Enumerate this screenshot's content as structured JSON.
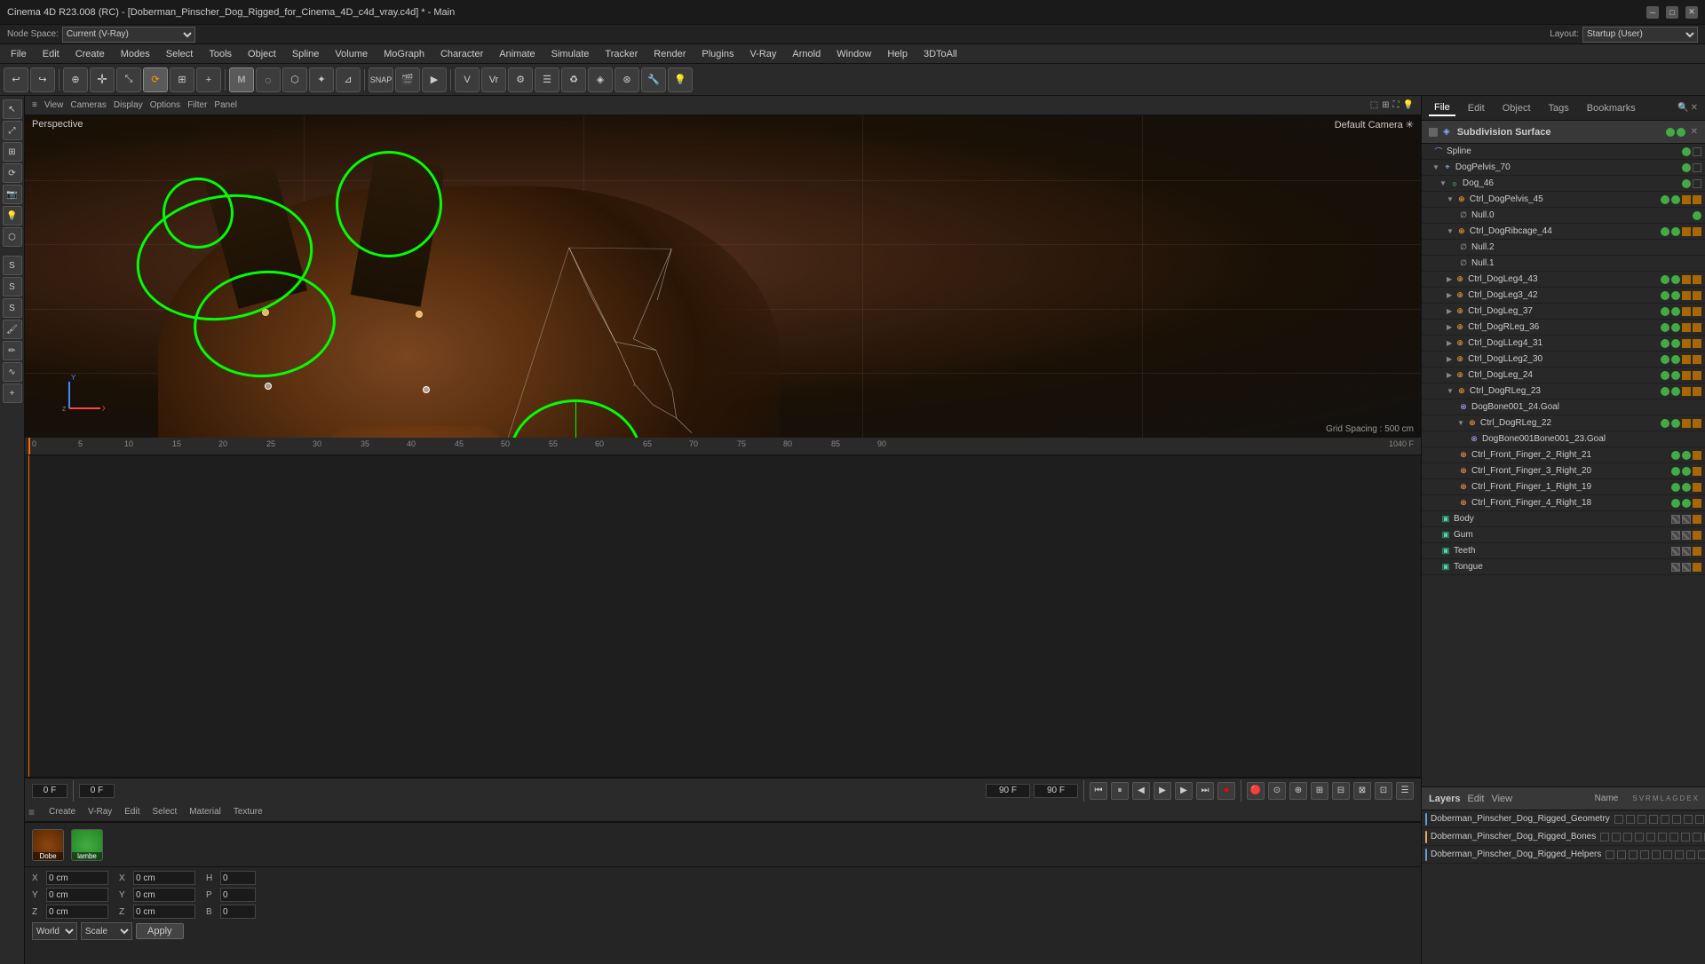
{
  "titlebar": {
    "title": "Cinema 4D R23.008 (RC) - [Doberman_Pinscher_Dog_Rigged_for_Cinema_4D_c4d_vray.c4d] * - Main",
    "minimize": "─",
    "maximize": "□",
    "close": "✕"
  },
  "menubar": {
    "items": [
      "File",
      "Edit",
      "Create",
      "Modes",
      "Select",
      "Tools",
      "Object",
      "Spline",
      "Volume",
      "MoGraph",
      "Character",
      "Animate",
      "Simulate",
      "Tracker",
      "Render",
      "Plugins",
      "V-Ray",
      "Arnold",
      "Window",
      "Help",
      "3DToAll"
    ]
  },
  "viewport": {
    "label": "Perspective",
    "camera": "Default Camera ✳",
    "grid_spacing": "Grid Spacing : 500 cm"
  },
  "node_space": {
    "label": "Node Space:",
    "value": "Current (V-Ray)"
  },
  "layout": {
    "label": "Layout:",
    "value": "Startup (User)"
  },
  "object_manager": {
    "tabs": [
      "File",
      "Edit",
      "Object",
      "Tags",
      "Bookmarks"
    ],
    "subdivision_surface": "Subdivision Surface",
    "items": [
      {
        "label": "Spline",
        "indent": 1,
        "has_fold": false,
        "icon": "spline"
      },
      {
        "label": "DogPelvis_70",
        "indent": 1,
        "has_fold": true,
        "icon": "bone"
      },
      {
        "label": "Dog_46",
        "indent": 2,
        "has_fold": true,
        "icon": "obj"
      },
      {
        "label": "Ctrl_DogPelvis_45",
        "indent": 3,
        "has_fold": true,
        "icon": "ctrl"
      },
      {
        "label": "Null.0",
        "indent": 4,
        "has_fold": false,
        "icon": "null"
      },
      {
        "label": "Ctrl_DogRibcage_44",
        "indent": 3,
        "has_fold": true,
        "icon": "ctrl"
      },
      {
        "label": "Null.2",
        "indent": 4,
        "has_fold": false,
        "icon": "null"
      },
      {
        "label": "Null.1",
        "indent": 4,
        "has_fold": false,
        "icon": "null"
      },
      {
        "label": "Ctrl_DogLeg4_43",
        "indent": 3,
        "has_fold": true,
        "icon": "ctrl"
      },
      {
        "label": "Ctrl_DogLeg3_42",
        "indent": 3,
        "has_fold": true,
        "icon": "ctrl"
      },
      {
        "label": "Ctrl_DogLeg_37",
        "indent": 3,
        "has_fold": true,
        "icon": "ctrl"
      },
      {
        "label": "Ctrl_DogRLeg_36",
        "indent": 3,
        "has_fold": true,
        "icon": "ctrl"
      },
      {
        "label": "Ctrl_DogLLeg4_31",
        "indent": 3,
        "has_fold": true,
        "icon": "ctrl"
      },
      {
        "label": "Ctrl_DogLLeg2_30",
        "indent": 3,
        "has_fold": true,
        "icon": "ctrl"
      },
      {
        "label": "Ctrl_DogLeg_24",
        "indent": 3,
        "has_fold": true,
        "icon": "ctrl"
      },
      {
        "label": "Ctrl_DogRLeg_23",
        "indent": 3,
        "has_fold": true,
        "icon": "ctrl"
      },
      {
        "label": "DogBone001_24.Goal",
        "indent": 4,
        "has_fold": false,
        "icon": "goal"
      },
      {
        "label": "Ctrl_DogRLeg_22",
        "indent": 4,
        "has_fold": true,
        "icon": "ctrl"
      },
      {
        "label": "DogBone001Bone001_23.Goal",
        "indent": 5,
        "has_fold": false,
        "icon": "goal"
      },
      {
        "label": "Ctrl_Front_Finger_2_Right_21",
        "indent": 4,
        "has_fold": false,
        "icon": "ctrl"
      },
      {
        "label": "Ctrl_Front_Finger_3_Right_20",
        "indent": 4,
        "has_fold": false,
        "icon": "ctrl"
      },
      {
        "label": "Ctrl_Front_Finger_1_Right_19",
        "indent": 4,
        "has_fold": false,
        "icon": "ctrl"
      },
      {
        "label": "Ctrl_Front_Finger_4_Right_18",
        "indent": 4,
        "has_fold": false,
        "icon": "ctrl"
      },
      {
        "label": "Body",
        "indent": 2,
        "has_fold": false,
        "icon": "mesh"
      },
      {
        "label": "Gum",
        "indent": 2,
        "has_fold": false,
        "icon": "mesh"
      },
      {
        "label": "Teeth",
        "indent": 2,
        "has_fold": false,
        "icon": "mesh"
      },
      {
        "label": "Tongue",
        "indent": 2,
        "has_fold": false,
        "icon": "mesh"
      }
    ]
  },
  "layers_panel": {
    "tabs": [
      "Layers",
      "Edit",
      "View"
    ],
    "name_col": "Name",
    "items": [
      {
        "name": "Doberman_Pinscher_Dog_Rigged_Geometry",
        "color": "#4488cc"
      },
      {
        "name": "Doberman_Pinscher_Dog_Rigged_Bones",
        "color": "#cc8844"
      },
      {
        "name": "Doberman_Pinscher_Dog_Rigged_Helpers",
        "color": "#4488cc"
      }
    ]
  },
  "coords": {
    "x_label": "X",
    "x_val": "0 cm",
    "x2_label": "X",
    "x2_val": "0 cm",
    "h_label": "H",
    "h_val": "0",
    "y_label": "Y",
    "y_val": "0 cm",
    "y2_label": "Y",
    "y2_val": "0 cm",
    "p_label": "P",
    "p_val": "0",
    "z_label": "Z",
    "z_val": "0 cm",
    "z2_label": "Z",
    "z2_val": "0 cm",
    "b_label": "B",
    "b_val": "0",
    "world_label": "World",
    "scale_label": "Scale",
    "apply_label": "Apply"
  },
  "materials": {
    "menu": [
      "Create",
      "V-Ray",
      "Edit",
      "Select",
      "Material",
      "Texture"
    ],
    "swatches": [
      {
        "name": "Dobe",
        "color": "#8B4513"
      },
      {
        "name": "lambe",
        "color": "#228B22"
      }
    ]
  },
  "timeline": {
    "marks": [
      "0",
      "5",
      "10",
      "15",
      "20",
      "25",
      "30",
      "35",
      "40",
      "45",
      "50",
      "55",
      "60",
      "65",
      "70",
      "75",
      "80",
      "85",
      "90"
    ],
    "current_frame": "0 F",
    "start_frame": "0 F",
    "end_frame": "90 F",
    "fps_display1": "90 F",
    "fps_display2": "90 F"
  },
  "playback": {
    "record_label": "⏺",
    "prev_end": "⏮",
    "prev_frame": "◀",
    "play_rev": "◀◀",
    "play": "▶",
    "play_fwd": "▶▶",
    "next_frame": "▶",
    "next_end": "⏭"
  }
}
